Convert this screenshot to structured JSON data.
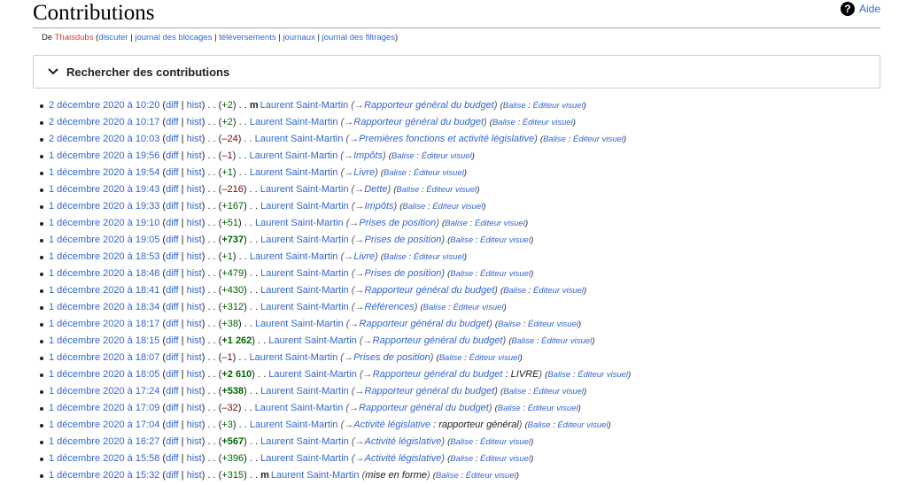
{
  "header": {
    "title": "Contributions",
    "help_label": "Aide"
  },
  "subtitle": {
    "prefix": "De",
    "user": "Thaisdubs",
    "links": [
      "discuter",
      "journal des blocages",
      "téléversements",
      "journaux",
      "journal des filtrages"
    ]
  },
  "search": {
    "title": "Rechercher des contributions"
  },
  "labels": {
    "diff": "diff",
    "hist": "hist",
    "tags_label": "Balise",
    "tag_value": "Éditeur visuel",
    "minor_flag": "m"
  },
  "colors": {
    "link": "#3366cc",
    "positive": "#006400",
    "negative": "#8b0000",
    "redlink": "#dd3333"
  },
  "contributions": [
    {
      "date": "2 décembre 2020 à 10:20",
      "size": "+2",
      "sign": "pos",
      "big": false,
      "minor": true,
      "page": "Laurent Saint-Martin",
      "section": "Rapporteur général du budget",
      "extra": ""
    },
    {
      "date": "2 décembre 2020 à 10:17",
      "size": "+2",
      "sign": "pos",
      "big": false,
      "minor": false,
      "page": "Laurent Saint-Martin",
      "section": "Rapporteur général du budget",
      "extra": ""
    },
    {
      "date": "2 décembre 2020 à 10:03",
      "size": "–24",
      "sign": "neg",
      "big": false,
      "minor": false,
      "page": "Laurent Saint-Martin",
      "section": "Premières fonctions et activité législative",
      "extra": ""
    },
    {
      "date": "1 décembre 2020 à 19:56",
      "size": "–1",
      "sign": "neg",
      "big": false,
      "minor": false,
      "page": "Laurent Saint-Martin",
      "section": "Impôts",
      "extra": ""
    },
    {
      "date": "1 décembre 2020 à 19:54",
      "size": "+1",
      "sign": "pos",
      "big": false,
      "minor": false,
      "page": "Laurent Saint-Martin",
      "section": "Livre",
      "extra": ""
    },
    {
      "date": "1 décembre 2020 à 19:43",
      "size": "–216",
      "sign": "neg",
      "big": false,
      "minor": false,
      "page": "Laurent Saint-Martin",
      "section": "Dette",
      "extra": ""
    },
    {
      "date": "1 décembre 2020 à 19:33",
      "size": "+167",
      "sign": "pos",
      "big": false,
      "minor": false,
      "page": "Laurent Saint-Martin",
      "section": "Impôts",
      "extra": ""
    },
    {
      "date": "1 décembre 2020 à 19:10",
      "size": "+51",
      "sign": "pos",
      "big": false,
      "minor": false,
      "page": "Laurent Saint-Martin",
      "section": "Prises de position",
      "extra": ""
    },
    {
      "date": "1 décembre 2020 à 19:05",
      "size": "+737",
      "sign": "pos",
      "big": true,
      "minor": false,
      "page": "Laurent Saint-Martin",
      "section": "Prises de position",
      "extra": ""
    },
    {
      "date": "1 décembre 2020 à 18:53",
      "size": "+1",
      "sign": "pos",
      "big": false,
      "minor": false,
      "page": "Laurent Saint-Martin",
      "section": "Livre",
      "extra": ""
    },
    {
      "date": "1 décembre 2020 à 18:48",
      "size": "+479",
      "sign": "pos",
      "big": false,
      "minor": false,
      "page": "Laurent Saint-Martin",
      "section": "Prises de position",
      "extra": ""
    },
    {
      "date": "1 décembre 2020 à 18:41",
      "size": "+430",
      "sign": "pos",
      "big": false,
      "minor": false,
      "page": "Laurent Saint-Martin",
      "section": "Rapporteur général du budget",
      "extra": ""
    },
    {
      "date": "1 décembre 2020 à 18:34",
      "size": "+312",
      "sign": "pos",
      "big": false,
      "minor": false,
      "page": "Laurent Saint-Martin",
      "section": "Références",
      "extra": ""
    },
    {
      "date": "1 décembre 2020 à 18:17",
      "size": "+38",
      "sign": "pos",
      "big": false,
      "minor": false,
      "page": "Laurent Saint-Martin",
      "section": "Rapporteur général du budget",
      "extra": ""
    },
    {
      "date": "1 décembre 2020 à 18:15",
      "size": "+1 262",
      "sign": "pos",
      "big": true,
      "minor": false,
      "page": "Laurent Saint-Martin",
      "section": "Rapporteur général du budget",
      "extra": ""
    },
    {
      "date": "1 décembre 2020 à 18:07",
      "size": "–1",
      "sign": "neg",
      "big": false,
      "minor": false,
      "page": "Laurent Saint-Martin",
      "section": "Prises de position",
      "extra": ""
    },
    {
      "date": "1 décembre 2020 à 18:05",
      "size": "+2 610",
      "sign": "pos",
      "big": true,
      "minor": false,
      "page": "Laurent Saint-Martin",
      "section": "Rapporteur général du budget",
      "extra": " : LIVRE"
    },
    {
      "date": "1 décembre 2020 à 17:24",
      "size": "+538",
      "sign": "pos",
      "big": true,
      "minor": false,
      "page": "Laurent Saint-Martin",
      "section": "Rapporteur général du budget",
      "extra": ""
    },
    {
      "date": "1 décembre 2020 à 17:09",
      "size": "–32",
      "sign": "neg",
      "big": false,
      "minor": false,
      "page": "Laurent Saint-Martin",
      "section": "Rapporteur général du budget",
      "extra": ""
    },
    {
      "date": "1 décembre 2020 à 17:04",
      "size": "+3",
      "sign": "pos",
      "big": false,
      "minor": false,
      "page": "Laurent Saint-Martin",
      "section": "Activité législative",
      "extra": " : rapporteur général"
    },
    {
      "date": "1 décembre 2020 à 16:27",
      "size": "+567",
      "sign": "pos",
      "big": true,
      "minor": false,
      "page": "Laurent Saint-Martin",
      "section": "Activité législative",
      "extra": ""
    },
    {
      "date": "1 décembre 2020 à 15:58",
      "size": "+396",
      "sign": "pos",
      "big": false,
      "minor": false,
      "page": "Laurent Saint-Martin",
      "section": "Activité législative",
      "extra": ""
    },
    {
      "date": "1 décembre 2020 à 15:32",
      "size": "+315",
      "sign": "pos",
      "big": false,
      "minor": true,
      "page": "Laurent Saint-Martin",
      "section": "",
      "extra": "mise en forme"
    }
  ]
}
